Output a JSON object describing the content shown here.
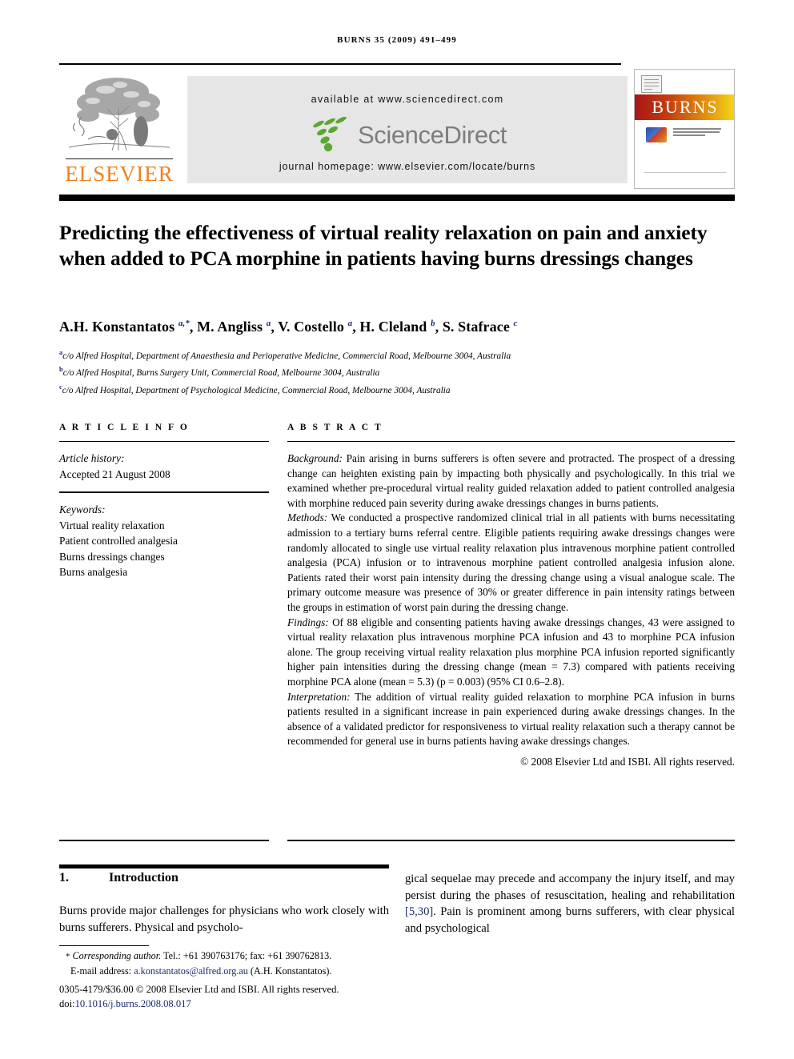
{
  "running_head": "BURNS 35 (2009) 491–499",
  "header": {
    "elsevier_wordmark": "ELSEVIER",
    "sciencedirect": {
      "available_at": "available at www.sciencedirect.com",
      "logo_text": "ScienceDirect",
      "homepage": "journal homepage: www.elsevier.com/locate/burns",
      "background_color": "#e6e6e6",
      "logo_green": "#5aa832",
      "logo_gray": "#7d7d7d"
    },
    "cover": {
      "journal_name": "BURNS",
      "band_gradient_start": "#a81616",
      "band_gradient_end": "#f5d818"
    }
  },
  "article": {
    "title": "Predicting the effectiveness of virtual reality relaxation on pain and anxiety when added to PCA morphine in patients having burns dressings changes",
    "authors_html": "A.H. Konstantatos <sup>a,*</sup>, M. Angliss <sup>a</sup>, V. Costello <sup>a</sup>, H. Cleland <sup>b</sup>, S. Stafrace <sup>c</sup>",
    "affiliations": [
      {
        "marker": "a",
        "text": "c/o Alfred Hospital, Department of Anaesthesia and Perioperative Medicine, Commercial Road, Melbourne 3004, Australia"
      },
      {
        "marker": "b",
        "text": "c/o Alfred Hospital, Burns Surgery Unit, Commercial Road, Melbourne 3004, Australia"
      },
      {
        "marker": "c",
        "text": "c/o Alfred Hospital, Department of Psychological Medicine, Commercial Road, Melbourne 3004, Australia"
      }
    ]
  },
  "article_info": {
    "heading": "A R T I C L E   I N F O",
    "history_label": "Article history:",
    "history_value": "Accepted 21 August 2008",
    "keywords_label": "Keywords:",
    "keywords": [
      "Virtual reality relaxation",
      "Patient controlled analgesia",
      "Burns dressings changes",
      "Burns analgesia"
    ]
  },
  "abstract": {
    "heading": "A B S T R A C T",
    "sections": [
      {
        "label": "Background:",
        "text": " Pain arising in burns sufferers is often severe and protracted. The prospect of a dressing change can heighten existing pain by impacting both physically and psychologically. In this trial we examined whether pre-procedural virtual reality guided relaxation added to patient controlled analgesia with morphine reduced pain severity during awake dressings changes in burns patients."
      },
      {
        "label": "Methods:",
        "text": " We conducted a prospective randomized clinical trial in all patients with burns necessitating admission to a tertiary burns referral centre. Eligible patients requiring awake dressings changes were randomly allocated to single use virtual reality relaxation plus intravenous morphine patient controlled analgesia (PCA) infusion or to intravenous morphine patient controlled analgesia infusion alone. Patients rated their worst pain intensity during the dressing change using a visual analogue scale. The primary outcome measure was presence of 30% or greater difference in pain intensity ratings between the groups in estimation of worst pain during the dressing change."
      },
      {
        "label": "Findings:",
        "text": " Of 88 eligible and consenting patients having awake dressings changes, 43 were assigned to virtual reality relaxation plus intravenous morphine PCA infusion and 43 to morphine PCA infusion alone. The group receiving virtual reality relaxation plus morphine PCA infusion reported significantly higher pain intensities during the dressing change (mean = 7.3) compared with patients receiving morphine PCA alone (mean = 5.3) (p = 0.003) (95% CI 0.6–2.8)."
      },
      {
        "label": "Interpretation:",
        "text": " The addition of virtual reality guided relaxation to morphine PCA infusion in burns patients resulted in a significant increase in pain experienced during awake dressings changes. In the absence of a validated predictor for responsiveness to virtual reality relaxation such a therapy cannot be recommended for general use in burns patients having awake dressings changes."
      }
    ],
    "copyright": "© 2008 Elsevier Ltd and ISBI. All rights reserved."
  },
  "introduction": {
    "number": "1.",
    "heading": "Introduction",
    "left_text": "Burns provide major challenges for physicians who work closely with burns sufferers. Physical and psycholo-",
    "right_text_before_ref": "gical sequelae may precede and accompany the injury itself, and may persist during the phases of resuscitation, healing and rehabilitation ",
    "right_reference": "[5,30]",
    "right_text_after_ref": ". Pain is prominent among burns sufferers, with clear physical and psychological"
  },
  "footnote": {
    "corresponding_label": "Corresponding author.",
    "corresponding_rest": " Tel.: +61 390763176; fax: +61 390762813.",
    "email_label": "E-mail address:",
    "email": "a.konstantatos@alfred.org.au",
    "email_attrib": " (A.H. Konstantatos).",
    "issn_line": "0305-4179/$36.00 © 2008 Elsevier Ltd and ISBI. All rights reserved.",
    "doi_label": "doi:",
    "doi_value": "10.1016/j.burns.2008.08.017"
  }
}
